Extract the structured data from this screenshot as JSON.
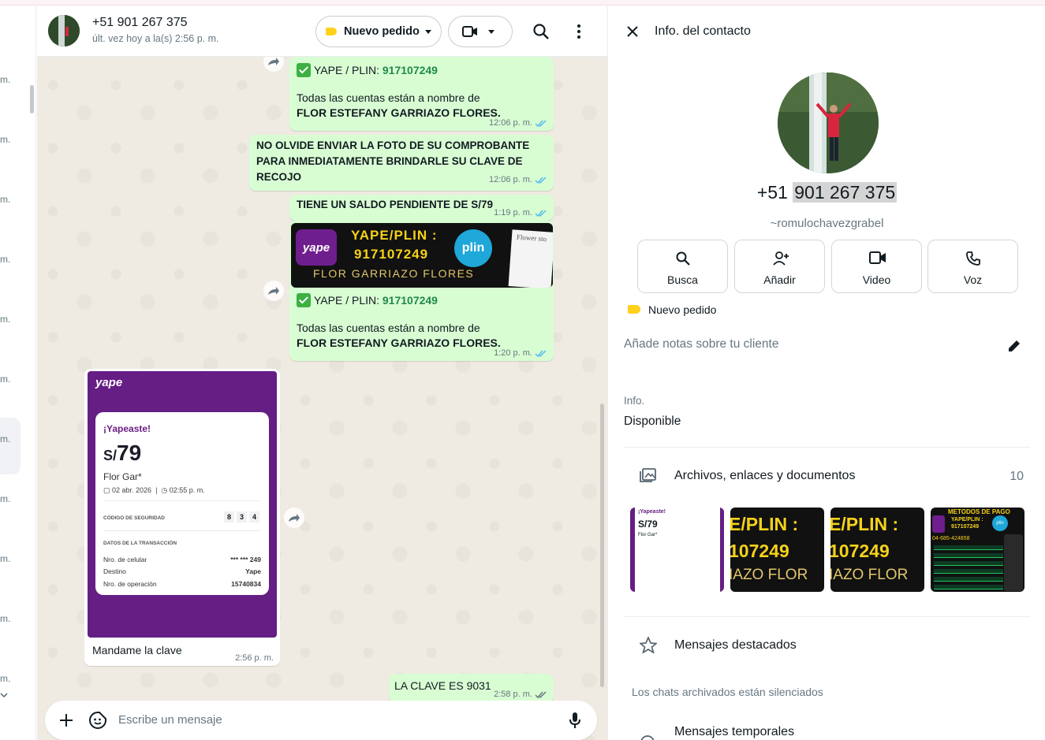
{
  "left_list": {
    "time_suffixes": [
      "m.",
      "m.",
      "m.",
      "m.",
      "m.",
      "m.",
      "m.",
      "m.",
      "m.",
      "m.",
      "m."
    ]
  },
  "chat": {
    "contact_name": "+51 901 267 375",
    "last_seen": "últ. vez hoy a la(s) 2:56 p. m.",
    "order_label": "Nuevo pedido",
    "messages": [
      {
        "pay_label": "YAPE / PLIN: ",
        "pay_number": "917107249",
        "line1": "Todas las cuentas están a nombre de",
        "line2": "FLOR ESTEFANY GARRIAZO FLORES.",
        "time": "12:06 p. m."
      },
      {
        "text": "NO OLVIDE ENVIAR LA FOTO DE SU COMPROBANTE PARA INMEDIATAMENTE BRINDARLE SU CLAVE DE RECOJO",
        "time": "12:06 p. m."
      },
      {
        "text": "TIENE UN SALDO PENDIENTE DE S/79",
        "time": "1:19 p. m."
      },
      {
        "pay_label": "YAPE / PLIN: ",
        "pay_number": "917107249",
        "line1": "Todas las cuentas están a nombre de",
        "line2": "FLOR ESTEFANY GARRIAZO FLORES.",
        "time": "1:20 p. m."
      },
      {
        "text": "Mandame la clave",
        "time": "2:56 p. m."
      },
      {
        "text": "LA CLAVE ES 9031",
        "time": "2:58 p. m."
      }
    ],
    "promo_image": {
      "logo": "yape",
      "title": "YAPE/PLIN :",
      "number": "917107249",
      "name": "FLOR GARRIAZO FLORES",
      "plin": "plin",
      "flyer": "Flower sto"
    },
    "receipt": {
      "logo": "yape",
      "title": "¡Yapeaste!",
      "currency": "S/",
      "amount": "79",
      "recipient": "Flor Gar*",
      "date": "02 abr. 2026",
      "clock": "02:55 p. m.",
      "security_label": "CÓDIGO DE SEGURIDAD",
      "security_code": [
        "8",
        "3",
        "4"
      ],
      "details_label": "DATOS DE LA TRANSACCIÓN",
      "rows": [
        {
          "k": "Nro. de celular",
          "v": "*** *** 249"
        },
        {
          "k": "Destino",
          "v": "Yape"
        },
        {
          "k": "Nro. de operación",
          "v": "15740834"
        }
      ]
    },
    "composer_placeholder": "Escribe un mensaje"
  },
  "info": {
    "title": "Info. del contacto",
    "phone_prefix": "+51 ",
    "phone_rest": "901 267 375",
    "username": "~romulochavezgrabel",
    "actions": [
      "Busca",
      "Añadir",
      "Video",
      "Voz"
    ],
    "label": "Nuevo pedido",
    "notes_placeholder": "Añade notas sobre tu cliente",
    "about_label": "Info.",
    "about_value": "Disponible",
    "media_label": "Archivos, enlaces y documentos",
    "media_count": "10",
    "media_thumbs": {
      "receipt": {
        "title": "¡Yapeaste!",
        "amount": "S/79",
        "who": "Flor Gar*"
      },
      "promo_a": {
        "l1": "E/PLIN :",
        "l2": "107249",
        "l3": "IAZO FLOR"
      },
      "promo_b": {
        "l1": "E/PLIN :",
        "l2": "107249",
        "l3": "IAZO FLOR"
      },
      "methods": {
        "title": "METODOS DE PAGO",
        "sub": "YAPE/PLIN :",
        "num": "917107249",
        "line": "04-685-424858",
        "tag": "plin"
      }
    },
    "starred_label": "Mensajes destacados",
    "archived_note": "Los chats archivados están silenciados",
    "temp_label": "Mensajes temporales"
  },
  "colors": {
    "outgoing_bubble": "#d9fdd3",
    "chat_bg": "#efeae2",
    "accent_green": "#1f8a4c",
    "tick_blue": "#53bdeb",
    "label_yellow": "#ffd11a"
  }
}
